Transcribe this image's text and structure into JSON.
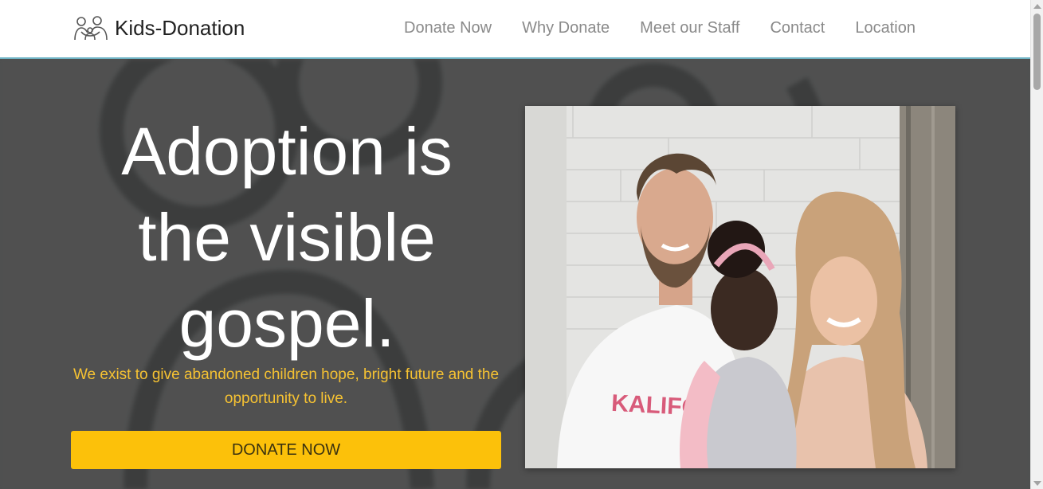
{
  "brand": {
    "name": "Kids-Donation",
    "icon": "family-icon"
  },
  "nav": {
    "items": [
      {
        "label": "Donate Now"
      },
      {
        "label": "Why Donate"
      },
      {
        "label": "Meet our Staff"
      },
      {
        "label": "Contact"
      },
      {
        "label": "Location"
      }
    ]
  },
  "hero": {
    "title_line1": "Adoption is",
    "title_line2": "the visible",
    "title_line3": "gospel.",
    "subtitle": "We exist to give abandoned children hope, bright future and the opportunity to live.",
    "cta_label": "DONATE NOW",
    "shirt_text": "KALIFORN"
  },
  "colors": {
    "accent": "#fcc10a",
    "subtitle": "#f6c232",
    "hero_bg": "#4e4f4f",
    "nav_border": "#6fb3c4"
  }
}
